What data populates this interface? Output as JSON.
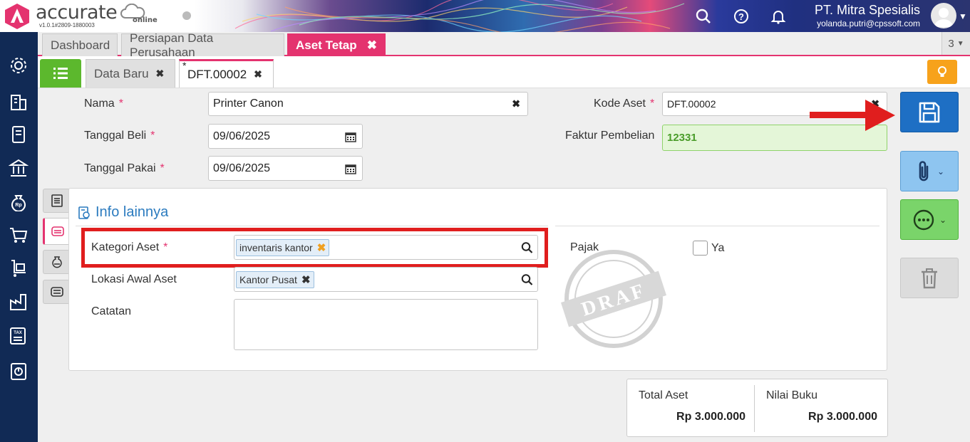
{
  "app": {
    "logo_text": "accurate",
    "logo_sub": "online",
    "version": "v1.0.1#2809-1880003",
    "company": "PT. Mitra Spesialis",
    "email": "yolanda.putri@cpssoft.com"
  },
  "header_icons": [
    "search-icon",
    "help-icon",
    "bell-icon"
  ],
  "sidebar_icons": [
    "gear-icon",
    "building-icon",
    "ledger-icon",
    "bank-icon",
    "money-bag-icon",
    "cart-icon",
    "handcart-icon",
    "factory-icon",
    "tax-icon",
    "report-icon"
  ],
  "tabs": [
    {
      "label": "Dashboard"
    },
    {
      "label": "Persiapan Data Perusahaan"
    },
    {
      "label": "Aset Tetap",
      "active": true
    }
  ],
  "tab_count": "3",
  "subtabs": [
    {
      "label": "Data Baru"
    },
    {
      "label": "DFT.00002",
      "modified_mark": "*",
      "active": true
    }
  ],
  "form": {
    "nama_label": "Nama",
    "nama_value": "Printer Canon",
    "tanggal_beli_label": "Tanggal Beli",
    "tanggal_beli_value": "09/06/2025",
    "tanggal_pakai_label": "Tanggal Pakai",
    "tanggal_pakai_value": "09/06/2025",
    "kode_aset_label": "Kode Aset",
    "kode_aset_value": "DFT.00002",
    "faktur_label": "Faktur Pembelian",
    "faktur_value": "12331",
    "required_mark": "*"
  },
  "info": {
    "title": "Info lainnya",
    "kategori_label": "Kategori Aset",
    "kategori_chip": "inventaris kantor",
    "lokasi_label": "Lokasi Awal Aset",
    "lokasi_chip": "Kantor Pusat",
    "catatan_label": "Catatan",
    "catatan_value": "",
    "pajak_label": "Pajak",
    "pajak_option": "Ya",
    "pajak_checked": false,
    "stamp_text": "DRAF"
  },
  "totals": {
    "total_aset_label": "Total Aset",
    "total_aset_value": "Rp 3.000.000",
    "nilai_buku_label": "Nilai Buku",
    "nilai_buku_value": "Rp 3.000.000"
  },
  "colors": {
    "accent": "#e4336f",
    "sidebar": "#112a55",
    "save": "#1e6fc4",
    "attach": "#8ec5f0",
    "more": "#7ad46a",
    "highlight": "#e01e1e",
    "link": "#2b7bbf"
  }
}
